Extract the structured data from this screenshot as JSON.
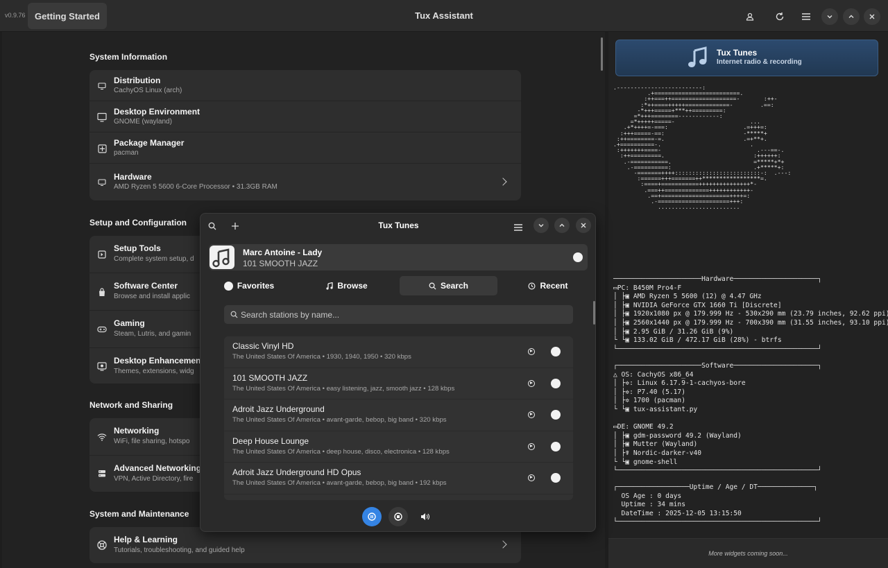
{
  "titlebar": {
    "version": "v0.9.76",
    "getting_started": "Getting Started",
    "title": "Tux Assistant",
    "icons": [
      "user-icon",
      "refresh-icon",
      "menu-icon",
      "minimize-icon",
      "maximize-icon",
      "close-icon"
    ]
  },
  "sections": [
    {
      "title": "System Information",
      "rows": [
        {
          "icon": "monitor-icon",
          "title": "Distribution",
          "subtitle": "CachyOS Linux (arch)",
          "chevron": false
        },
        {
          "icon": "display-icon",
          "title": "Desktop Environment",
          "subtitle": "GNOME (wayland)",
          "chevron": false
        },
        {
          "icon": "package-icon",
          "title": "Package Manager",
          "subtitle": "pacman",
          "chevron": false
        },
        {
          "icon": "monitor-icon",
          "title": "Hardware",
          "subtitle": "AMD Ryzen 5 5600 6-Core Processor • 31.3GB RAM",
          "chevron": true
        }
      ]
    },
    {
      "title": "Setup and Configuration",
      "rows": [
        {
          "icon": "setup-icon",
          "title": "Setup Tools",
          "subtitle": "Complete system setup, d",
          "chevron": false
        },
        {
          "icon": "shopping-bag-icon",
          "title": "Software Center",
          "subtitle": "Browse and install applic",
          "chevron": false
        },
        {
          "icon": "gamepad-icon",
          "title": "Gaming",
          "subtitle": "Steam, Lutris, and gamin",
          "chevron": false
        },
        {
          "icon": "desktop-enhance-icon",
          "title": "Desktop Enhancement",
          "subtitle": "Themes, extensions, widg",
          "chevron": false
        }
      ]
    },
    {
      "title": "Network and Sharing",
      "rows": [
        {
          "icon": "wifi-icon",
          "title": "Networking",
          "subtitle": "WiFi, file sharing, hotspo",
          "chevron": false
        },
        {
          "icon": "server-icon",
          "title": "Advanced Networking",
          "subtitle": "VPN, Active Directory, fire",
          "chevron": false
        }
      ]
    },
    {
      "title": "System and Maintenance",
      "rows": [
        {
          "icon": "help-icon",
          "title": "Help & Learning",
          "subtitle": "Tutorials, troubleshooting, and guided help",
          "chevron": true
        }
      ]
    }
  ],
  "side": {
    "tux_tunes_title": "Tux Tunes",
    "tux_tunes_subtitle": "Internet radio & recording",
    "ascii_logo": ".-------------------------:\n          .+=========================.\n         :++===++===================-       :++-\n        :*++====+++++=============-        .==:\n       -*+++=====+***++=========:\n      =*+++========------------:\n     =*+++++=====-                      ...\n   .+*++++=-===:                      .=+++=:\n  :+++=====-==:                       -*****+\n :++========-=.                       .=+**+.\n.+==========-.                          .\n :+++++++====-                            .---==-.\n  :++=========.                          :++++++:\n   .-===========.                        =*****+*+\n    .-==========:                        .+*****+:\n      -=======++++:::::::::::::::::::::::::-:  .---:\n       :======+++=======++*****************=.\n        :====+===========+++++++++++++++*-\n         .===++=============++++++++++++-\n          .==+====================++++=:\n           .-=====================+++:\n             ........................",
    "fastfetch_hw": "──────────────────────Hardware─────────────────────┐\n▭PC: B450M Pro4-F\n│ ├▣ AMD Ryzen 5 5600 (12) @ 4.47 GHz\n│ ├▣ NVIDIA GeForce GTX 1660 Ti [Discrete]\n│ ├▣ 1920x1080 px @ 179.999 Hz - 530x290 mm (23.79 inches, 92.62 ppi)\n│ ├▣ 2560x1440 px @ 179.999 Hz - 700x390 mm (31.55 inches, 93.10 ppi)\n│ ├▣ 2.95 GiB / 31.26 GiB (9%)\n└ └▣ 133.02 GiB / 472.17 GiB (28%) - btrfs\n└──────────────────────────────────────────────────┘",
    "fastfetch_sw": "┌─────────────────────Software─────────────────────┐\n△ OS: CachyOS x86_64\n│ ├✲: Linux 6.17.9-1-cachyos-bore\n│ ├✲: P7.40 (5.17)\n│ ├✲ 1700 (pacman)\n└ └▣ tux-assistant.py\n\n▭DE: GNOME 49.2\n│ ├▣ gdm-password 49.2 (Wayland)\n│ ├▣ Mutter (Wayland)\n│ ├☤ Nordic-darker-v40\n└ └▣ gnome-shell\n└──────────────────────────────────────────────────┘",
    "fastfetch_uptime": "┌──────────────────Uptime / Age / DT──────────────┐\n  OS Age : 0 days\n  Uptime : 34 mins\n  DateTime : 2025-12-05 13:15:50\n└──────────────────────────────────────────────────┘",
    "footer": "More widgets coming soon..."
  },
  "tunes": {
    "title": "Tux Tunes",
    "now_playing": {
      "title": "Marc Antoine - Lady",
      "station": "101 SMOOTH JAZZ"
    },
    "tabs": [
      {
        "icon": "circle-icon",
        "label": "Favorites",
        "active": false
      },
      {
        "icon": "music-note-icon",
        "label": "Browse",
        "active": false
      },
      {
        "icon": "search-icon",
        "label": "Search",
        "active": true
      },
      {
        "icon": "clock-icon",
        "label": "Recent",
        "active": false
      }
    ],
    "search_placeholder": "Search stations by name...",
    "stations": [
      {
        "name": "Classic Vinyl HD",
        "details": "The United States Of America • 1930, 1940, 1950 • 320 kbps"
      },
      {
        "name": "101 SMOOTH JAZZ",
        "details": "The United States Of America • easy listening, jazz, smooth jazz • 128 kbps"
      },
      {
        "name": "Adroit Jazz Underground",
        "details": "The United States Of America • avant-garde, bebop, big band • 320 kbps"
      },
      {
        "name": "Deep House Lounge",
        "details": "The United States Of America • deep house, disco, electronica • 128 kbps"
      },
      {
        "name": "Adroit Jazz Underground HD Opus",
        "details": "The United States Of America • avant-garde, bebop, big band • 192 kbps"
      }
    ],
    "accent": "#3584e4"
  }
}
